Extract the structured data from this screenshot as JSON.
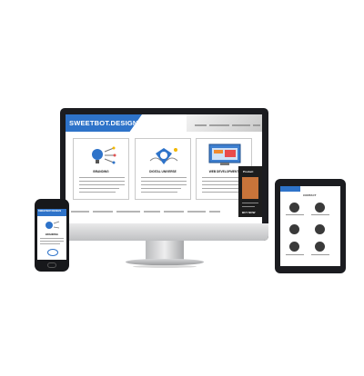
{
  "brand": {
    "name": "SWEETBOT.DESIGN",
    "accent": "#2e73c9"
  },
  "features": [
    {
      "title": "BRANDING",
      "icon": "lightbulb-icon"
    },
    {
      "title": "DIGITAL UNIVERSE",
      "icon": "cloud-icon"
    },
    {
      "title": "WEB DEVELOPMENT",
      "icon": "browser-icon"
    }
  ],
  "popup": {
    "title": "Product",
    "footer": "BUY NOW"
  },
  "tablet": {
    "title": "CONTACT"
  },
  "phone": {
    "title": "SWEETBOT.DESIGN",
    "section": "BRANDING"
  }
}
